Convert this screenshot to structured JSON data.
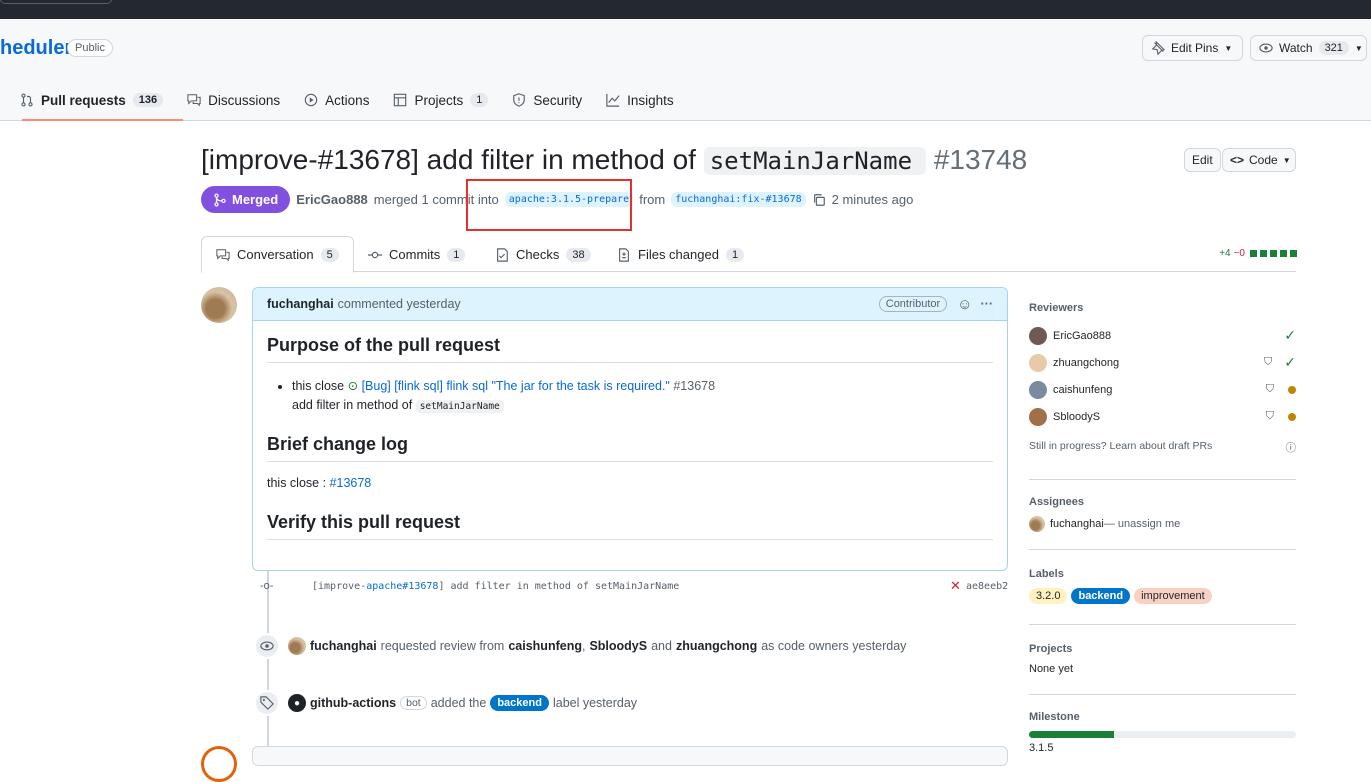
{
  "repo": {
    "name": "heduler",
    "visibility": "Public",
    "edit_pins": "Edit Pins",
    "watch": "Watch",
    "watch_count": "321"
  },
  "nav": [
    {
      "label": "Pull requests",
      "count": "136",
      "icon": "git-pull-request-icon"
    },
    {
      "label": "Discussions",
      "icon": "comment-discussion-icon"
    },
    {
      "label": "Actions",
      "icon": "play-icon"
    },
    {
      "label": "Projects",
      "count": "1",
      "icon": "table-icon"
    },
    {
      "label": "Security",
      "icon": "shield-icon"
    },
    {
      "label": "Insights",
      "icon": "graph-icon"
    }
  ],
  "pr": {
    "title": "[improve-#13678] add filter in method of",
    "title_code": "setMainJarName",
    "number": "#13748",
    "edit": "Edit",
    "code": "Code",
    "state": "Merged",
    "author": "EricGao888",
    "merged_text": "merged 1 commit into",
    "base_branch": "apache:3.1.5-prepare",
    "from": "from",
    "head_branch": "fuchanghai:fix-#13678",
    "time": "2 minutes ago"
  },
  "tabs": [
    {
      "label": "Conversation",
      "count": "5"
    },
    {
      "label": "Commits",
      "count": "1"
    },
    {
      "label": "Checks",
      "count": "38"
    },
    {
      "label": "Files changed",
      "count": "1"
    }
  ],
  "diffstat": {
    "add": "+4",
    "del": "−0"
  },
  "comment": {
    "author": "fuchanghai",
    "meta": "commented yesterday",
    "badge": "Contributor",
    "h1": "Purpose of the pull request",
    "li_prefix": "this close",
    "li_link": "[Bug] [flink sql] flink sql \"The jar for the task is required.\"",
    "li_ref": "#13678",
    "li_line2": "add filter in method of",
    "li_code": "setMainJarName",
    "h2": "Brief change log",
    "p2_prefix": "this close :",
    "p2_link": "#13678",
    "h3": "Verify this pull request"
  },
  "commit": {
    "msg_prefix": "[improve-",
    "msg_link": "apache#13678",
    "msg_suffix": "] add filter in method of setMainJarName",
    "sha": "ae8eeb2"
  },
  "events": {
    "review_user": "fuchanghai",
    "review_text": "requested review from",
    "review_u1": "caishunfeng",
    "review_sep": ",",
    "review_u2": "SbloodyS",
    "review_and": "and",
    "review_u3": "zhuangchong",
    "review_tail": "as code owners yesterday",
    "label_user": "github-actions",
    "label_bot": "bot",
    "label_text": "added the",
    "label_name": "backend",
    "label_tail": "label yesterday"
  },
  "sidebar": {
    "reviewers_title": "Reviewers",
    "reviewers": [
      "EricGao888",
      "zhuangchong",
      "caishunfeng",
      "SbloodyS"
    ],
    "draft_text": "Still in progress?",
    "draft_link": "Learn about draft PRs",
    "assignees_title": "Assignees",
    "assignee": "fuchanghai",
    "unassign": "— unassign me",
    "labels_title": "Labels",
    "labels": [
      "3.2.0",
      "backend",
      "improvement"
    ],
    "projects_title": "Projects",
    "projects_value": "None yet",
    "milestone_title": "Milestone",
    "milestone_value": "3.1.5",
    "milestone_progress": 0.32
  },
  "colors": {
    "merged": "#8250df",
    "link": "#0969da",
    "backend": "#0075ca",
    "improvement": "#f9d0c4"
  }
}
